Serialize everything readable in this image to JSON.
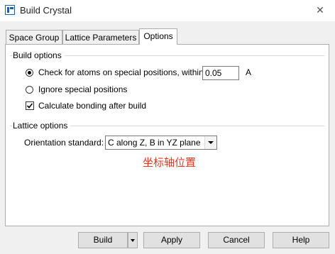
{
  "window": {
    "title": "Build Crystal",
    "close_glyph": "✕"
  },
  "tabs": [
    {
      "label": "Space Group",
      "active": false
    },
    {
      "label": "Lattice Parameters",
      "active": false
    },
    {
      "label": "Options",
      "active": true
    }
  ],
  "build_options": {
    "group_label": "Build options",
    "check_special": {
      "label": "Check for atoms on special positions, within",
      "selected": true
    },
    "tolerance": {
      "value": "0.05",
      "unit": "A"
    },
    "ignore_special": {
      "label": "Ignore special positions",
      "selected": false
    },
    "calculate_bonding": {
      "label": "Calculate bonding after build",
      "checked": true
    }
  },
  "lattice_options": {
    "group_label": "Lattice options",
    "orientation_label": "Orientation standard:",
    "orientation_value": "C along Z, B in YZ plane"
  },
  "annotation": {
    "text": "坐标轴位置",
    "color": "#e8361e"
  },
  "buttons": {
    "build": "Build",
    "apply": "Apply",
    "cancel": "Cancel",
    "help": "Help"
  },
  "icons": {
    "app": "build-crystal-app-icon",
    "close": "close-icon",
    "dropdown": "chevron-down-icon"
  }
}
